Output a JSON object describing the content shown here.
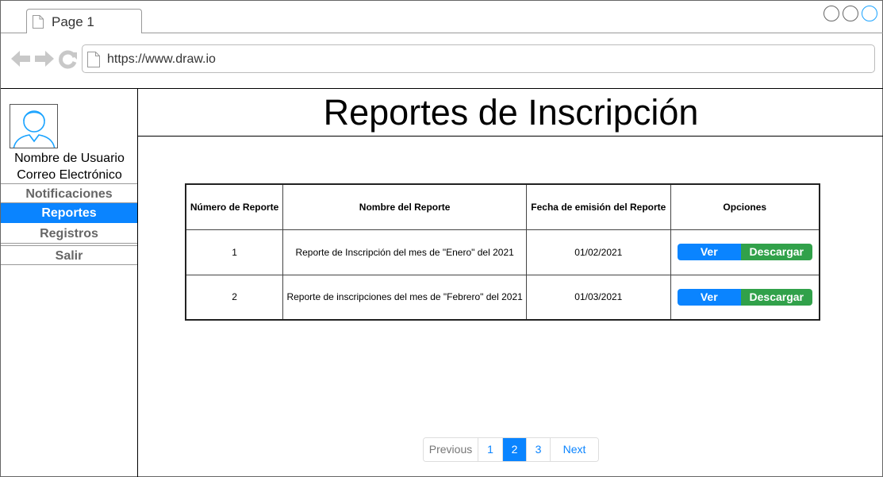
{
  "browser": {
    "tab_label": "Page 1",
    "url": "https://www.draw.io"
  },
  "sidebar": {
    "user_name": "Nombre de Usuario",
    "user_email": "Correo Electrónico",
    "items": [
      {
        "label": "Notificaciones",
        "active": false
      },
      {
        "label": "Reportes",
        "active": true
      },
      {
        "label": "Registros",
        "active": false
      },
      {
        "label": "Salir",
        "active": false
      }
    ]
  },
  "page": {
    "title": "Reportes de Inscripción"
  },
  "table": {
    "headers": [
      "Número de Reporte",
      "Nombre del Reporte",
      "Fecha de emisión del Reporte",
      "Opciones"
    ],
    "rows": [
      {
        "number": "1",
        "name": "Reporte de Inscripción del mes de \"Enero\" del 2021",
        "date": "01/02/2021"
      },
      {
        "number": "2",
        "name": "Reporte de inscripciones del mes de \"Febrero\" del 2021",
        "date": "01/03/2021"
      }
    ],
    "view_label": "Ver",
    "download_label": "Descargar"
  },
  "pagination": {
    "previous": "Previous",
    "pages": [
      "1",
      "2",
      "3"
    ],
    "current": "2",
    "next": "Next"
  },
  "colors": {
    "primary": "#0a84ff",
    "success": "#31a14a"
  }
}
